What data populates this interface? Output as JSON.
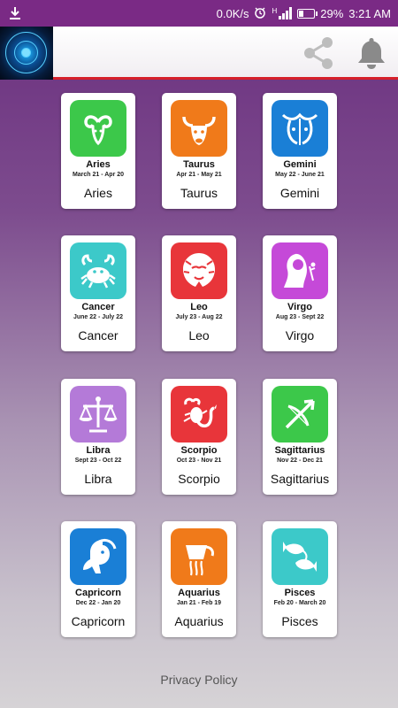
{
  "status_bar": {
    "speed": "0.0K/s",
    "network": "H",
    "battery": "29%",
    "battery_level": 0.29,
    "time": "3:21 AM",
    "icons": [
      "download-icon",
      "alarm-icon",
      "signal-icon",
      "battery-icon"
    ]
  },
  "header": {
    "logo_icon": "zodiac-wheel-icon",
    "share_icon": "share-icon",
    "bell_icon": "bell-icon"
  },
  "signs": [
    {
      "title": "Aries",
      "dates": "March 21 - Apr 20",
      "label": "Aries",
      "color": "#3cc84a",
      "icon": "ram-icon"
    },
    {
      "title": "Taurus",
      "dates": "Apr 21 - May 21",
      "label": "Taurus",
      "color": "#f07a1a",
      "icon": "bull-icon"
    },
    {
      "title": "Gemini",
      "dates": "May 22 - June 21",
      "label": "Gemini",
      "color": "#1a7fd6",
      "icon": "twins-icon"
    },
    {
      "title": "Cancer",
      "dates": "June 22 - July 22",
      "label": "Cancer",
      "color": "#3cc9c9",
      "icon": "crab-icon"
    },
    {
      "title": "Leo",
      "dates": "July 23 - Aug 22",
      "label": "Leo",
      "color": "#e8353a",
      "icon": "lion-icon"
    },
    {
      "title": "Virgo",
      "dates": "Aug 23 - Sept 22",
      "label": "Virgo",
      "color": "#c549d8",
      "icon": "maiden-icon"
    },
    {
      "title": "Libra",
      "dates": "Sept 23 - Oct 22",
      "label": "Libra",
      "color": "#b47ad8",
      "icon": "scales-icon"
    },
    {
      "title": "Scorpio",
      "dates": "Oct 23 - Nov 21",
      "label": "Scorpio",
      "color": "#e8353a",
      "icon": "scorpion-icon"
    },
    {
      "title": "Sagittarius",
      "dates": "Nov 22 - Dec 21",
      "label": "Sagittarius",
      "color": "#3cc84a",
      "icon": "archer-icon"
    },
    {
      "title": "Capricorn",
      "dates": "Dec 22 - Jan 20",
      "label": "Capricorn",
      "color": "#1a7fd6",
      "icon": "goat-icon"
    },
    {
      "title": "Aquarius",
      "dates": "Jan 21 - Feb 19",
      "label": "Aquarius",
      "color": "#f07a1a",
      "icon": "water-bearer-icon"
    },
    {
      "title": "Pisces",
      "dates": "Feb 20 - March 20",
      "label": "Pisces",
      "color": "#3cc9c9",
      "icon": "fish-icon"
    }
  ],
  "footer": {
    "privacy_label": "Privacy Policy"
  }
}
